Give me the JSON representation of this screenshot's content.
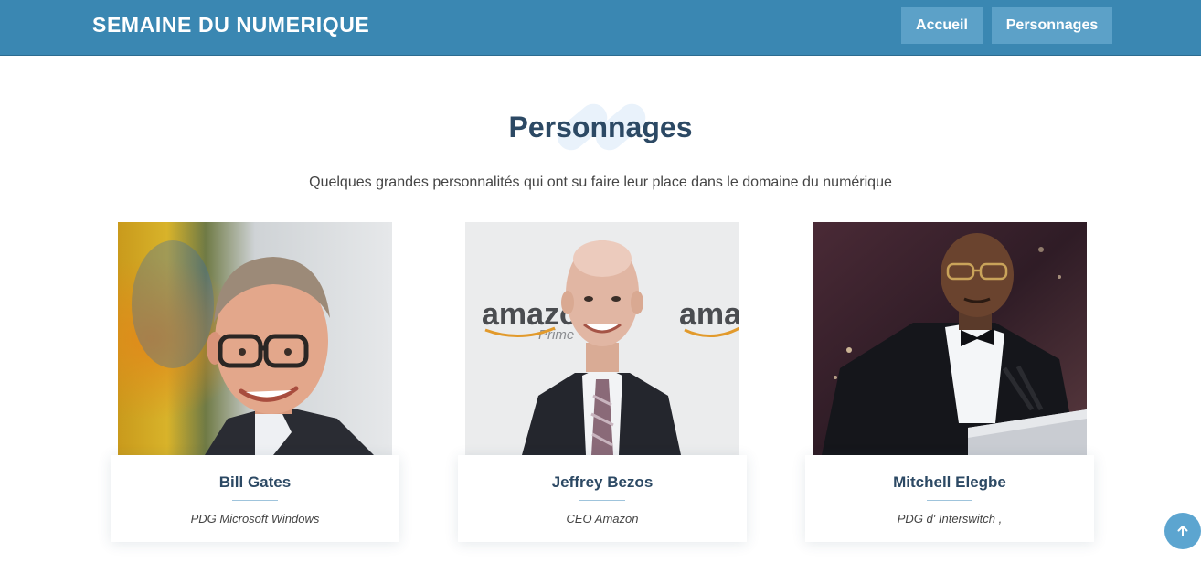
{
  "header": {
    "brand": "SEMAINE DU NUMERIQUE",
    "nav": {
      "home_label": "Accueil",
      "people_label": "Personnages"
    }
  },
  "section": {
    "title": "Personnages",
    "subtitle": "Quelques grandes personnalités qui ont su faire leur place dans le domaine du numérique"
  },
  "people": [
    {
      "name": "Bill Gates",
      "role": "PDG Microsoft Windows"
    },
    {
      "name": "Jeffrey Bezos",
      "role": "CEO Amazon",
      "backdrop_text": "amazon",
      "backdrop_subtext": "Prime"
    },
    {
      "name": "Mitchell Elegbe",
      "role": "PDG d' Interswitch ,"
    }
  ],
  "colors": {
    "header_bg": "#3a87b2",
    "nav_button_bg": "#5ca1c8",
    "title_color": "#2c4964",
    "back_to_top_bg": "#5ca5d0"
  },
  "icons": {
    "back_to_top": "arrow-up-icon"
  }
}
